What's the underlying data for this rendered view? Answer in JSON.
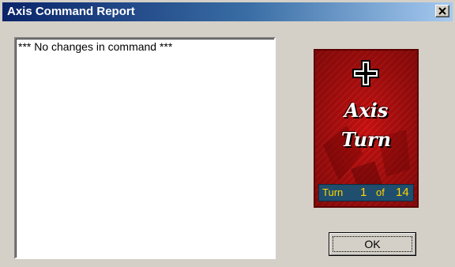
{
  "window": {
    "title": "Axis Command Report",
    "close_icon": "close-icon"
  },
  "report": {
    "lines": [
      "*** No changes in command ***"
    ]
  },
  "turn_panel": {
    "emblem_icon": "balkenkreuz-icon",
    "word1": "Axis",
    "word2": "Turn",
    "counter": {
      "label": "Turn",
      "current": "1",
      "of_label": "of",
      "total": "14"
    },
    "colors": {
      "background": "#c81010",
      "counter_bg": "#1f4e6e",
      "counter_text": "#ffd400"
    }
  },
  "buttons": {
    "ok_label": "OK"
  }
}
